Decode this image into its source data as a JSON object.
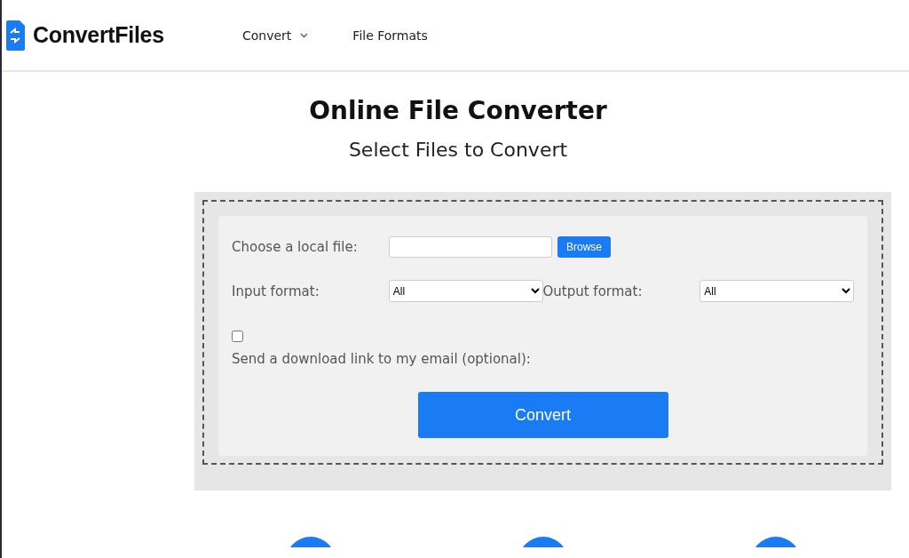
{
  "header": {
    "logo": "ConvertFiles",
    "nav": [
      {
        "label": "Convert",
        "dropdown": true
      },
      {
        "label": "File Formats",
        "dropdown": false
      }
    ]
  },
  "title": "Online File Converter",
  "subtitle": "Select Files to Convert",
  "form": {
    "file_label": "Choose a local file:",
    "browse_button": "Browse",
    "input_format_label": "Input format:",
    "input_format_value": "All",
    "output_format_label": "Output format:",
    "output_format_value": "All",
    "email_checkbox": {
      "checked": false
    },
    "email_label": "Send a download link to my email (optional):",
    "convert_button": "Convert"
  },
  "features": [
    {
      "kind": "circle"
    },
    {
      "kind": "circle"
    },
    {
      "kind": "circle"
    }
  ]
}
